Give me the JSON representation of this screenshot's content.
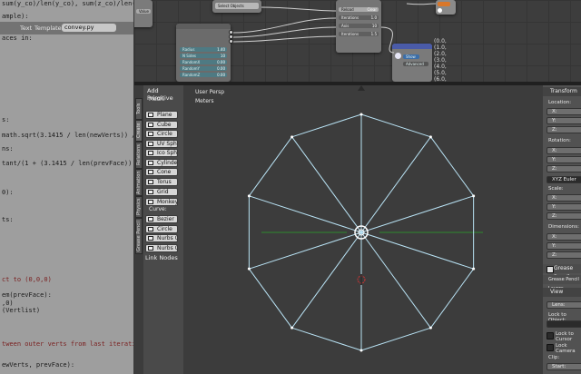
{
  "text_editor": {
    "top_lines": [
      "sum(y_co)/len(y_co), sum(z_co)/len(z_co)",
      "",
      "aces in:",
      "",
      "ample):"
    ],
    "header": {
      "btn1": "Text",
      "btn2": "Templates",
      "file_name": "convey.py"
    },
    "code_lines": [
      {
        "t": "s:"
      },
      {
        "t": "math.sqrt(3.1415 / len(newVerts)) / 20"
      },
      {
        "t": "ns:"
      },
      {
        "t": "tant/(1 + (3.1415 / len(prevFace)) *"
      },
      {
        "t": "0):"
      },
      {
        "t": "ts:"
      },
      {
        "t": "ct to (0,0,0)",
        "red": true
      },
      {
        "t": "em(prevFace):"
      },
      {
        "t": ",0)"
      },
      {
        "t": "(Vertlist)"
      },
      {
        "t": "tween outer verts from last iteration",
        "red": true
      },
      {
        "t": "ewVerts, prevFace):"
      }
    ]
  },
  "node_editor": {
    "top_buttons": [
      "Select Objects",
      "Value"
    ],
    "node_fields": [
      {
        "label": "Radius",
        "value": "1.40"
      },
      {
        "label": "N Sides",
        "value": "10"
      },
      {
        "label": "RandomX",
        "value": "0.00"
      },
      {
        "label": "RandomY",
        "value": "0.00"
      },
      {
        "label": "RandomZ",
        "value": "0.00"
      }
    ],
    "node2_rows": [
      {
        "label": "Reload",
        "value": "Clear"
      },
      {
        "label": "Iterations",
        "value": "1.0"
      },
      {
        "label": "Axis",
        "value": "10"
      },
      {
        "label": "Iterations",
        "value": "1.5"
      }
    ],
    "side_numbers": [
      "(0.0,",
      "(1.0,",
      "(2.0,",
      "(3.0,",
      "(4.0,",
      "(5.0,",
      "(6.0,"
    ],
    "viewer_buttons": [
      "Show",
      "Advanced"
    ]
  },
  "tool_panel": {
    "section_add": "Add Primitive",
    "tabs": [
      "Tools",
      "Create",
      "Relations",
      "Animation",
      "Physics",
      "Grease Pencil"
    ],
    "mesh_label": "Mesh:",
    "mesh_items": [
      "Plane",
      "Cube",
      "Circle",
      "UV Sphere",
      "Ico Sphere",
      "Cylinder",
      "Cone",
      "Torus",
      "Grid",
      "Monkey"
    ],
    "curve_label": "Curve:",
    "curve_items": [
      "Bezier",
      "Circle",
      "Nurbs Curve",
      "Nurbs Circle"
    ],
    "section_link": "Link Nodes"
  },
  "viewport": {
    "view_label": "User Persp",
    "unit_label": "Meters"
  },
  "properties": {
    "transform": "Transform",
    "location": "Location:",
    "x": "X:",
    "y": "Y:",
    "z": "Z:",
    "rotation": "Rotation:",
    "rot_mode": "XYZ Euler",
    "scale": "Scale:",
    "dimensions": "Dimensions:",
    "grease": "Grease Pencil",
    "grease2": "Grease Pencil Layers",
    "view": "View",
    "lens": "Lens:",
    "lock_to": "Lock to Object:",
    "lock_cursor": "Lock to Cursor",
    "lock_camera": "Lock Camera",
    "clip": "Clip:",
    "start": "Start:"
  },
  "colors": {
    "wire": "#b9e3f5",
    "axis_green": "#2e8a2e"
  }
}
